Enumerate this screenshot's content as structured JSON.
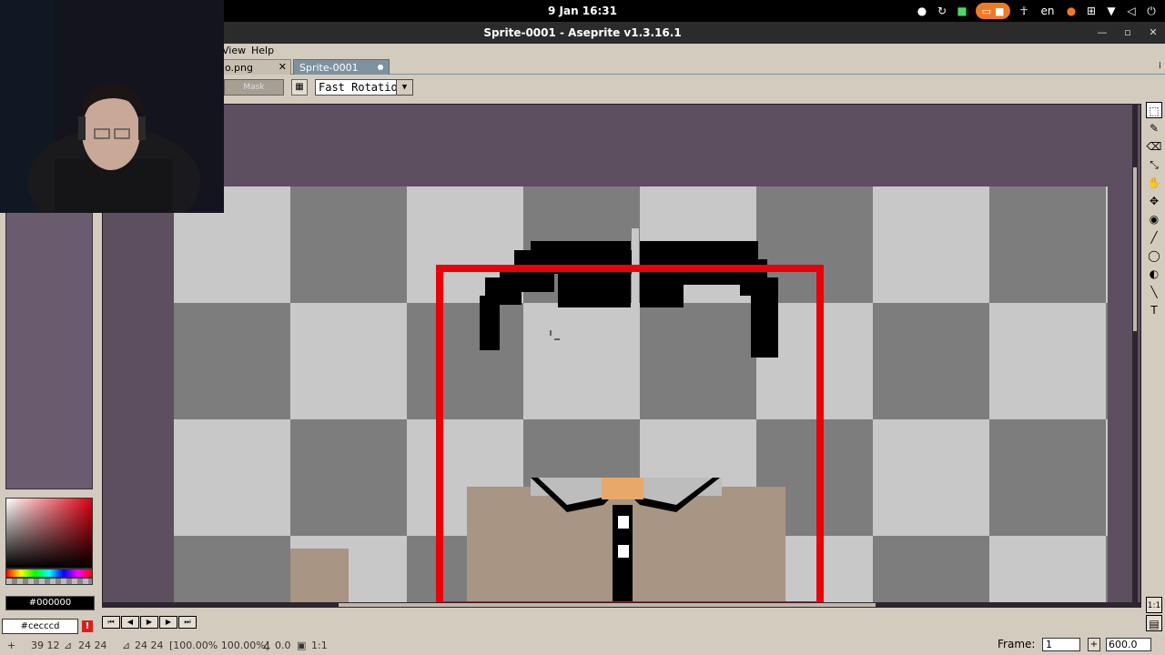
{
  "topbar": {
    "clock": "9 Jan  16:31",
    "language": "en",
    "icons": [
      "steam-icon",
      "update-icon",
      "lock-icon",
      "screencast-icon",
      "accessibility-icon",
      "microphone-icon",
      "network-icon",
      "wifi-icon",
      "volume-icon",
      "power-icon"
    ]
  },
  "window": {
    "title": "Sprite-0001 - Aseprite v1.3.16.1"
  },
  "menu": {
    "view": "View",
    "help": "Help"
  },
  "tabs": [
    {
      "label": "o.png",
      "close": "✕"
    },
    {
      "label": "Sprite-0001"
    }
  ],
  "context_bar": {
    "mask_label": "Mask",
    "rotation_algorithm": "Fast Rotation"
  },
  "colors": {
    "foreground_hex": "#000000",
    "background_hex": "#cecccd",
    "accent_tab": "#7d929e",
    "selection_rect": "#e8000a"
  },
  "status_bar": {
    "cursor_pos": "39 12",
    "selection_size": "24 24",
    "selection_size2": "24 24",
    "scale": "[100.00% 100.00%]",
    "angle": "0.0",
    "ratio": "1:1"
  },
  "frame": {
    "label": "Frame:",
    "value": "1",
    "zoom": "600.0"
  },
  "right_tools": [
    "marquee-tool",
    "pencil-tool",
    "eraser-tool",
    "eyedropper-tool",
    "hand-tool",
    "move-tool",
    "fill-tool",
    "line-tool",
    "ellipse-tool",
    "contour-tool",
    "blur-tool",
    "text-tool"
  ]
}
